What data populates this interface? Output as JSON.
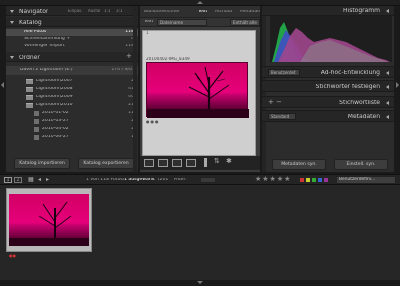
{
  "left": {
    "navigator": {
      "title": "Navigator",
      "options": [
        "Einpas.",
        "Ausfül",
        "1:1",
        "3:1"
      ]
    },
    "katalog": {
      "title": "Katalog",
      "items": [
        {
          "label": "Alle Fotos",
          "count": "118"
        },
        {
          "label": "Schnellsammlung +",
          "count": "0"
        },
        {
          "label": "Vorheriger Import",
          "count": "118"
        }
      ]
    },
    "ordner": {
      "title": "Ordner",
      "volume": {
        "label": "Daten 2 Lightroom (E:)",
        "info": "170 / 9/0"
      },
      "folders": [
        {
          "label": "Lightroom\\2007",
          "count": "2"
        },
        {
          "label": "Lightroom\\2008",
          "count": "41"
        },
        {
          "label": "Lightroom\\2009",
          "count": "40"
        },
        {
          "label": "Lightroom\\2010",
          "count": "21"
        }
      ],
      "subfolders": [
        {
          "label": "2010-01-02",
          "count": "11"
        },
        {
          "label": "2010-03-27",
          "count": "2"
        },
        {
          "label": "2010-04-02",
          "count": "2"
        },
        {
          "label": "2010-06-27",
          "count": "1"
        }
      ]
    },
    "buttons": {
      "import": "Katalog importieren",
      "export": "Katalog exportieren"
    }
  },
  "center": {
    "filter": {
      "label": "Bibliotheksfilter",
      "tabs": [
        "Text",
        "Attribut",
        "Metadaten"
      ]
    },
    "search": {
      "label": "Text",
      "dropdown": "Dateiname",
      "dropdown2": "Enthält alle"
    },
    "cell": {
      "index": "1",
      "filename": "20100402-IMG_8349"
    }
  },
  "right": {
    "histogram": {
      "title": "Histogramm"
    },
    "quickdev": {
      "title": "Ad-hoc-Entwicklung",
      "preset": "Benutzerdef."
    },
    "keywords": {
      "title": "Stichwörter festlegen"
    },
    "keywordlist": {
      "title": "Stichwortliste"
    },
    "metadata": {
      "title": "Metadaten",
      "preset": "Standard"
    },
    "buttons": {
      "sync_meta": "Metadaten syn.",
      "sync_settings": "Einstell. syn."
    }
  },
  "status": {
    "page1": "1",
    "page2": "2",
    "summary": "1 von 118 Fotos/",
    "selected": "1 ausgewählt",
    "selected_file": "/201",
    "filter_label": "Filter:",
    "filter_preset": "Benutzerdefini..."
  },
  "colors": {
    "photo_magenta": "#e6007a",
    "accent_selection": "#4a4a4a"
  }
}
